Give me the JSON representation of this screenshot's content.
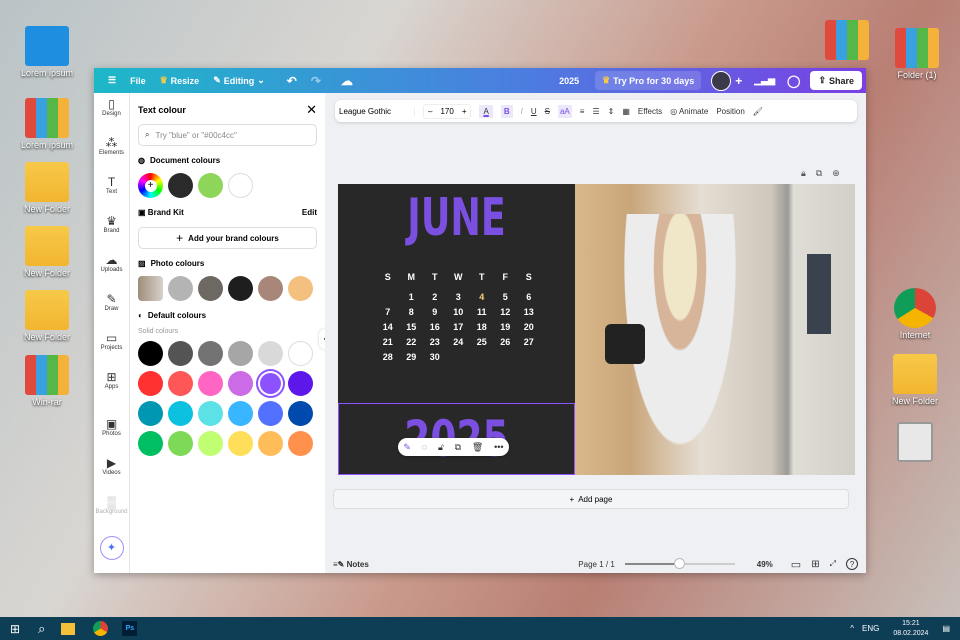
{
  "desktop": {
    "left": [
      "Lorem ipsum",
      "Lorem ipsum",
      "New Folder",
      "New Folder",
      "New Folder",
      "Win-rar"
    ],
    "right": [
      "Folder (1)",
      "Internet",
      "New Folder"
    ]
  },
  "topbar": {
    "file": "File",
    "resize": "Resize",
    "editing": "Editing",
    "title": "2025",
    "try_pro": "Try Pro for 30 days",
    "share": "Share"
  },
  "rail": [
    {
      "label": "Design",
      "icon": "▯"
    },
    {
      "label": "Elements",
      "icon": "⁂"
    },
    {
      "label": "Text",
      "icon": "T"
    },
    {
      "label": "Brand",
      "icon": "♛"
    },
    {
      "label": "Uploads",
      "icon": "☁"
    },
    {
      "label": "Draw",
      "icon": "✎"
    },
    {
      "label": "Projects",
      "icon": "▭"
    },
    {
      "label": "Apps",
      "icon": "⊞"
    },
    {
      "label": "Photos",
      "icon": "▣"
    },
    {
      "label": "Videos",
      "icon": "▶"
    },
    {
      "label": "Background",
      "icon": "▒"
    }
  ],
  "panel": {
    "title": "Text colour",
    "search_placeholder": "Try \"blue\" or \"#00c4cc\"",
    "document_colours": "Document colours",
    "brand_kit": "Brand Kit",
    "edit": "Edit",
    "add_brand": "Add your brand colours",
    "photo_colours": "Photo colours",
    "default_colours": "Default colours",
    "solid_colours": "Solid colours",
    "doc_swatches": [
      "#2a2a2a",
      "#8ed65a",
      "#ffffff"
    ],
    "photo_swatches": [
      "#b4b4b4",
      "#6d6861",
      "#1e1e1e",
      "#a8877a",
      "#f3c07f"
    ],
    "default_swatches": [
      [
        "#000000",
        "#545454",
        "#737373",
        "#a6a6a6",
        "#d9d9d9",
        "#ffffff"
      ],
      [
        "#ff3131",
        "#ff5757",
        "#ff66c4",
        "#cb6ce6",
        "#8c52ff",
        "#5e17eb"
      ],
      [
        "#0097b2",
        "#0cc0df",
        "#5ce1e6",
        "#38b6ff",
        "#5271ff",
        "#004aad"
      ],
      [
        "#00bf63",
        "#7ed957",
        "#c1ff72",
        "#ffde59",
        "#ffbd59",
        "#ff914d"
      ]
    ],
    "selected": "#8c52ff"
  },
  "toolbar": {
    "font": "League Gothic",
    "size": "170",
    "effects": "Effects",
    "animate": "Animate",
    "position": "Position"
  },
  "design": {
    "month": "JUNE",
    "year": "2025",
    "days": [
      "S",
      "M",
      "T",
      "W",
      "T",
      "F",
      "S"
    ],
    "dates": [
      "",
      "1",
      "2",
      "3",
      "4",
      "5",
      "6",
      "7",
      "8",
      "9",
      "10",
      "11",
      "12",
      "13",
      "14",
      "15",
      "16",
      "17",
      "18",
      "19",
      "20",
      "21",
      "22",
      "23",
      "24",
      "25",
      "26",
      "27",
      "28",
      "29",
      "30",
      "",
      "",
      "",
      ""
    ],
    "accent": "#7b4fe0"
  },
  "add_page": "Add page",
  "footer": {
    "notes": "Notes",
    "page": "Page 1 / 1",
    "zoom": "49%",
    "zoom_fraction": 0.49
  },
  "taskbar": {
    "lang": "ENG",
    "time": "15:21",
    "date": "08.02.2024",
    "ps": "Ps"
  }
}
